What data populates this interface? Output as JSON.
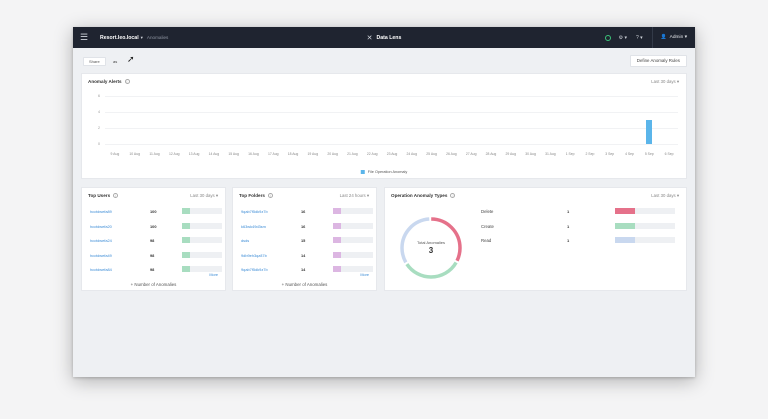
{
  "topbar": {
    "host": "Resort.leo.local",
    "breadcrumb": "Anomalies",
    "title": "Data Lens",
    "settings_label": "⚙ ▾",
    "help_label": "? ▾",
    "user_label": "Admin ▾"
  },
  "filters": {
    "share_label": "Share",
    "share_value": "as",
    "define_button": "Define Anomaly Rules"
  },
  "anomaly_alerts": {
    "title": "Anomaly Alerts",
    "range": "Last 30 days ▾",
    "legend": "File Operation Anomaly",
    "color": "#5bb5ea",
    "chart_data": {
      "type": "bar",
      "categories": [
        "9 Aug",
        "10 Aug",
        "11 Aug",
        "12 Aug",
        "13 Aug",
        "14 Aug",
        "15 Aug",
        "16 Aug",
        "17 Aug",
        "18 Aug",
        "19 Aug",
        "20 Aug",
        "21 Aug",
        "22 Aug",
        "23 Aug",
        "24 Aug",
        "25 Aug",
        "26 Aug",
        "27 Aug",
        "28 Aug",
        "29 Aug",
        "30 Aug",
        "31 Aug",
        "1 Sep",
        "2 Sep",
        "3 Sep",
        "4 Sep",
        "5 Sep",
        "6 Sep"
      ],
      "values": [
        0,
        0,
        0,
        0,
        0,
        0,
        0,
        0,
        0,
        0,
        0,
        0,
        0,
        0,
        0,
        0,
        0,
        0,
        0,
        0,
        0,
        0,
        0,
        0,
        0,
        0,
        0,
        3,
        0
      ],
      "yticks": [
        "6",
        "4",
        "2",
        "0"
      ],
      "ylim": [
        0,
        6
      ],
      "series": [
        {
          "name": "File Operation Anomaly",
          "color": "#5bb5ea"
        }
      ]
    }
  },
  "top_users": {
    "title": "Top Users",
    "range": "Last 30 days ▾",
    "more": "More",
    "footer": "+ Number of Anomalies",
    "color": "#a8ddc0",
    "rows": [
      {
        "name": "hcctdwefa89",
        "value": "100",
        "fill": 0.2
      },
      {
        "name": "hcctdwefa20",
        "value": "100",
        "fill": 0.2
      },
      {
        "name": "hcctdwefa24",
        "value": "98",
        "fill": 0.2
      },
      {
        "name": "hcctdwefa49",
        "value": "98",
        "fill": 0.2
      },
      {
        "name": "hcctdwefa84",
        "value": "98",
        "fill": 0.2
      }
    ]
  },
  "top_folders": {
    "title": "Top Folders",
    "range": "Last 24 hours ▾",
    "more": "More",
    "footer": "+ Number of Anomalies",
    "color": "#dcb6e2",
    "rows": [
      {
        "name": "9qab7f5dk9z7b",
        "value": "16",
        "fill": 0.2
      },
      {
        "name": "k63wk49d3sm",
        "value": "16",
        "fill": 0.2
      },
      {
        "name": "dsds",
        "value": "15",
        "fill": 0.2
      },
      {
        "name": "9db9eh3qz87b",
        "value": "14",
        "fill": 0.2
      },
      {
        "name": "9qab7f5dk9z7b",
        "value": "14",
        "fill": 0.2
      }
    ]
  },
  "operation_types": {
    "title": "Operation Anomaly Types",
    "range": "Last 30 days ▾",
    "donut_label": "Total Anomalies",
    "donut_value": "3",
    "rows": [
      {
        "name": "Delete",
        "value": "1",
        "color": "#e5718a",
        "fill": 0.34
      },
      {
        "name": "Create",
        "value": "1",
        "color": "#a8ddc0",
        "fill": 0.34
      },
      {
        "name": "Read",
        "value": "1",
        "color": "#c9d8ef",
        "fill": 0.34
      }
    ]
  }
}
